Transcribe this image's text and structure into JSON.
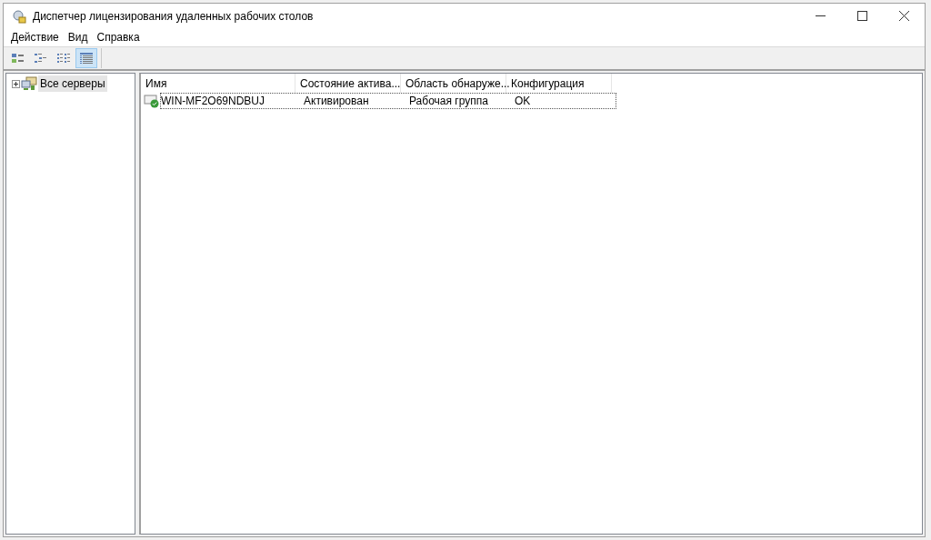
{
  "window": {
    "title": "Диспетчер лицензирования удаленных рабочих столов"
  },
  "menu": [
    "Действие",
    "Вид",
    "Справка"
  ],
  "toolbar": [
    {
      "kind": "large",
      "selected": false
    },
    {
      "kind": "small",
      "selected": false
    },
    {
      "kind": "list",
      "selected": false
    },
    {
      "kind": "details",
      "selected": true
    }
  ],
  "tree": [
    {
      "label": "Все серверы",
      "expanded": false,
      "selected": true
    }
  ],
  "table": {
    "columns": [
      "Имя",
      "Состояние актива...",
      "Область обнаруже...",
      "Конфигурация"
    ],
    "rows": [
      {
        "cells": [
          "WIN-MF2O69NDBUJ",
          "Активирован",
          "Рабочая группа",
          "OK"
        ],
        "selected": true
      }
    ]
  }
}
